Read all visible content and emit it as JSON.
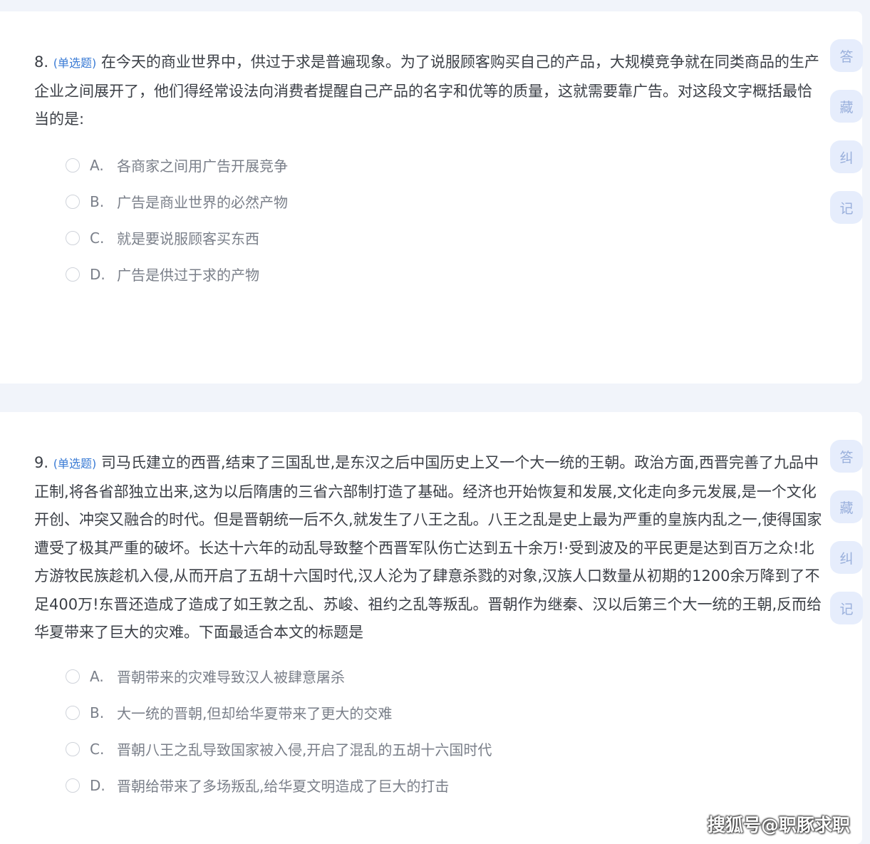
{
  "questions": [
    {
      "number": "8.",
      "type": "(单选题)",
      "stem": "在今天的商业世界中，供过于求是普遍现象。为了说服顾客购买自己的产品，大规模竞争就在同类商品的生产企业之间展开了，他们得经常设法向消费者提醒自己产品的名字和优等的质量，这就需要靠广告。对这段文字概括最恰当的是:",
      "options": [
        {
          "letter": "A.",
          "text": "各商家之间用广告开展竞争"
        },
        {
          "letter": "B.",
          "text": "广告是商业世界的必然产物"
        },
        {
          "letter": "C.",
          "text": "就是要说服顾客买东西"
        },
        {
          "letter": "D.",
          "text": "广告是供过于求的产物"
        }
      ]
    },
    {
      "number": "9.",
      "type": "(单选题)",
      "stem": "司马氏建立的西晋,结束了三国乱世,是东汉之后中国历史上又一个大一统的王朝。政治方面,西晋完善了九品中正制,将各省部独立出来,这为以后隋唐的三省六部制打造了基础。经济也开始恢复和发展,文化走向多元发展,是一个文化开创、冲突又融合的时代。但是晋朝统一后不久,就发生了八王之乱。八王之乱是史上最为严重的皇族内乱之一,使得国家遭受了极其严重的破坏。长达十六年的动乱导致整个西晋军队伤亡达到五十余万!·受到波及的平民更是达到百万之众!北方游牧民族趁机入侵,从而开启了五胡十六国时代,汉人沦为了肆意杀戮的对象,汉族人口数量从初期的1200余万降到了不足400万!东晋还造成了造成了如王敦之乱、苏峻、祖约之乱等叛乱。晋朝作为继秦、汉以后第三个大一统的王朝,反而给华夏带来了巨大的灾难。下面最适合本文的标题是",
      "options": [
        {
          "letter": "A.",
          "text": "晋朝带来的灾难导致汉人被肆意屠杀"
        },
        {
          "letter": "B.",
          "text": "大一统的晋朝,但却给华夏带来了更大的交难"
        },
        {
          "letter": "C.",
          "text": "晋朝八王之乱导致国家被入侵,开启了混乱的五胡十六国时代"
        },
        {
          "letter": "D.",
          "text": "晋朝给带来了多场叛乱,给华夏文明造成了巨大的打击"
        }
      ]
    }
  ],
  "side_buttons": [
    "答",
    "藏",
    "纠",
    "记"
  ],
  "watermark": "搜狐号@职豚求职",
  "colors": {
    "page_bg": "#f1f4fa",
    "card_bg": "#ffffff",
    "question_type": "#3a7bd5",
    "side_button_bg": "#e6edfc",
    "side_button_text": "#9ab0dc"
  }
}
